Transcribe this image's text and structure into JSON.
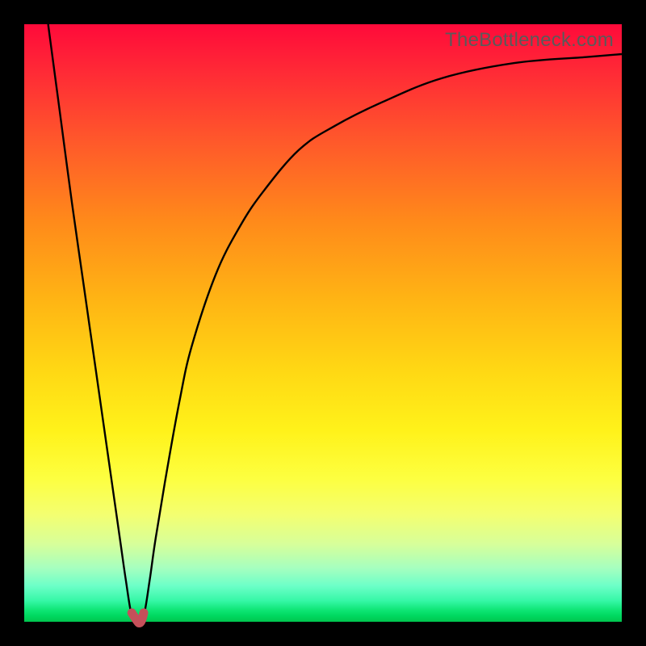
{
  "attribution": "TheBottleneck.com",
  "chart_data": {
    "type": "line",
    "title": "",
    "xlabel": "",
    "ylabel": "",
    "xlim": [
      0,
      100
    ],
    "ylim": [
      0,
      100
    ],
    "grid": false,
    "legend": false,
    "series": [
      {
        "name": "curve",
        "x": [
          4,
          6,
          8,
          10,
          12,
          14,
          16,
          17,
          18,
          19,
          20,
          21,
          22,
          24,
          26,
          28,
          32,
          36,
          40,
          46,
          52,
          60,
          70,
          82,
          94,
          100
        ],
        "y": [
          100,
          85,
          70,
          56,
          42,
          28,
          14,
          7,
          1,
          0,
          1,
          7,
          14,
          26,
          37,
          46,
          58,
          66,
          72,
          79,
          83,
          87,
          91,
          93.5,
          94.5,
          95
        ]
      }
    ],
    "marker": {
      "name": "bottleneck-point",
      "x": [
        18,
        19,
        20
      ],
      "y": [
        1.5,
        0,
        1.5
      ]
    }
  },
  "colors": {
    "background": "#000000",
    "gradient_top": "#ff0a3a",
    "gradient_bottom": "#00c54e",
    "attribution_text": "#5a5a5a",
    "curve": "#000000",
    "marker": "#c5505a"
  }
}
